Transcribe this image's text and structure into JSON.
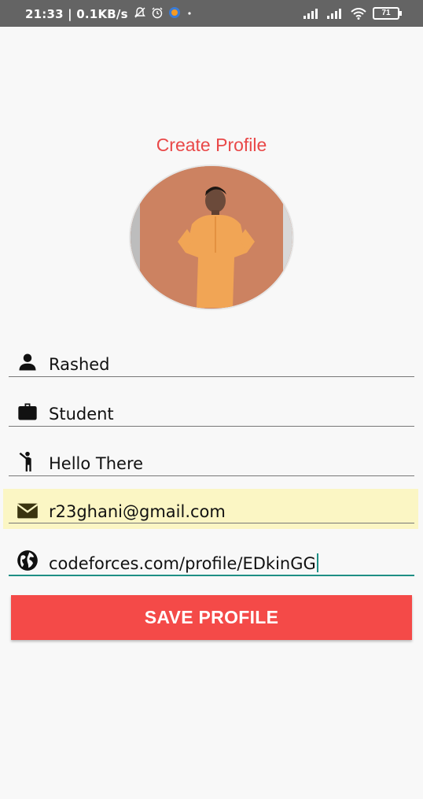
{
  "status_bar": {
    "time": "21:33 | 0.1KB/s",
    "battery": "71"
  },
  "screen": {
    "title": "Create Profile"
  },
  "form": {
    "name": "Rashed",
    "occupation": "Student",
    "bio": "Hello There",
    "email": "r23ghani@gmail.com",
    "website": "codeforces.com/profile/EDkinGG"
  },
  "actions": {
    "save_label": "SAVE PROFILE"
  },
  "colors": {
    "accent": "#f44a48",
    "title": "#e94848",
    "focus_underline": "#1e8f85",
    "autofill_highlight": "#fbf6c4"
  }
}
